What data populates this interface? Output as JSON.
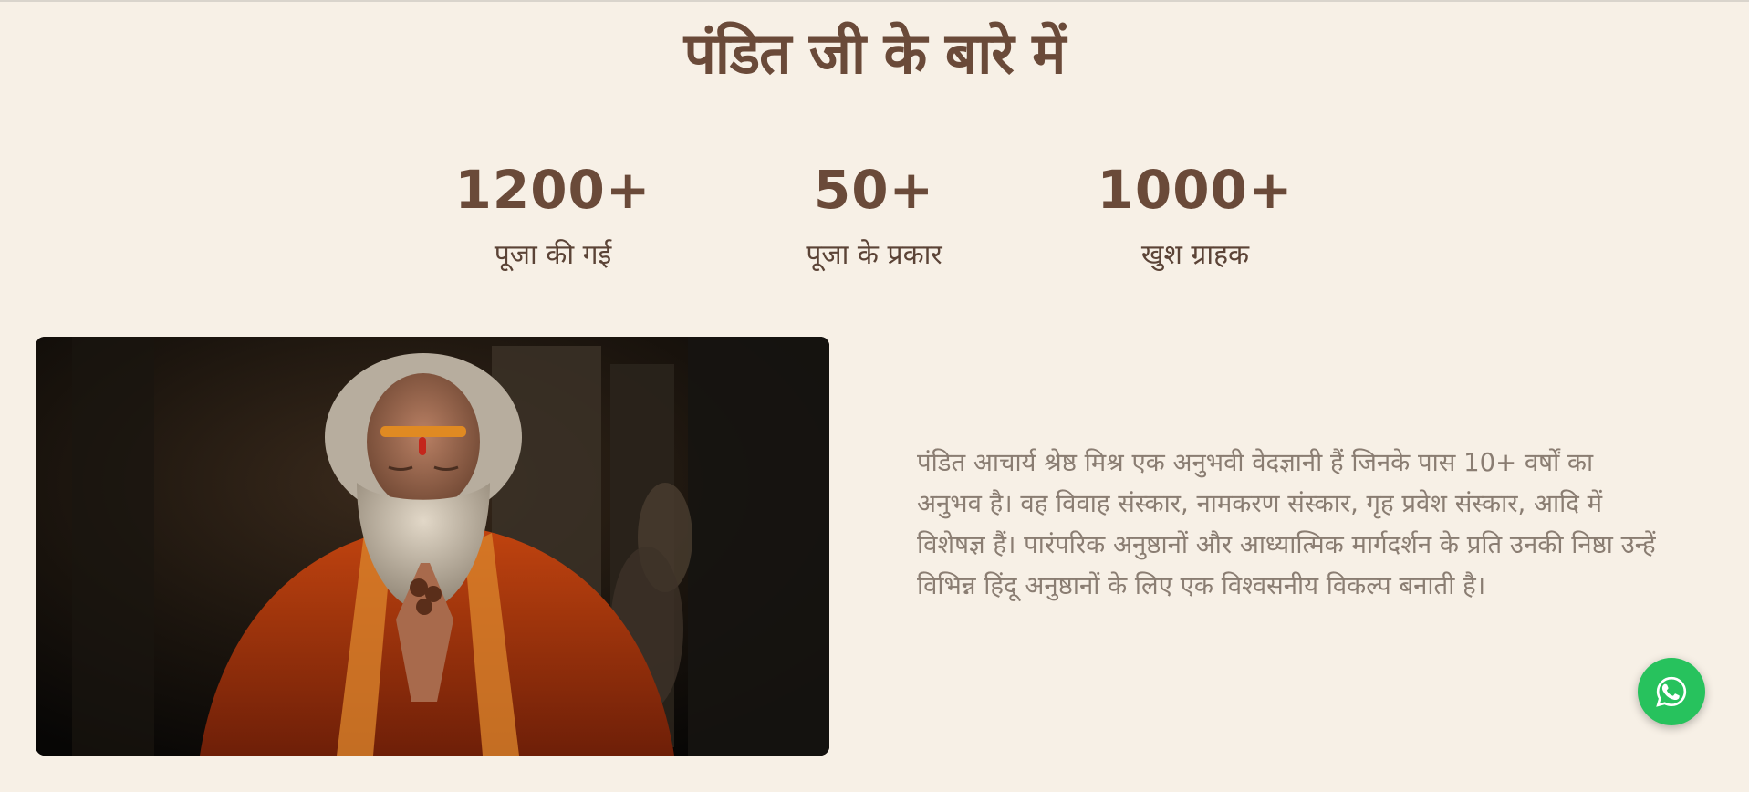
{
  "about": {
    "title": "पंडित जी के बारे में",
    "stats": [
      {
        "value": "1200+",
        "label": "पूजा की गई"
      },
      {
        "value": "50+",
        "label": "पूजा के प्रकार"
      },
      {
        "value": "1000+",
        "label": "खुश ग्राहक"
      }
    ],
    "description": "पंडित आचार्य श्रेष्ठ मिश्र एक अनुभवी वेदज्ञानी हैं जिनके पास 10+ वर्षों का अनुभव है। वह विवाह संस्कार, नामकरण संस्कार, गृह प्रवेश संस्कार, आदि में विशेषज्ञ हैं। पारंपरिक अनुष्ठानों और आध्यात्मिक मार्गदर्शन के प्रति उनकी निष्ठा उन्हें विभिन्न हिंदू अनुष्ठानों के लिए एक विश्वसनीय विकल्प बनाती है।"
  },
  "whatsapp": {
    "icon": "whatsapp-icon",
    "color": "#27c25d"
  },
  "colors": {
    "background": "#f7f0e6",
    "heading": "#6a4a39",
    "body_text": "#8a7d72"
  }
}
